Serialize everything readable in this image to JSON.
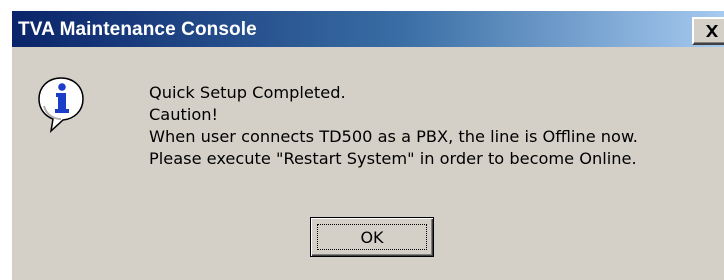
{
  "window": {
    "title": "TVA Maintenance Console",
    "close_glyph": "✕"
  },
  "icon": {
    "name": "info-icon",
    "colors": {
      "fill": "#ffffff",
      "glyph": "#1a3ec8",
      "outline": "#000000"
    }
  },
  "message": {
    "lines": [
      "Quick Setup Completed.",
      "Caution!",
      "When user connects TD500 as a PBX, the line is Offline now.",
      "Please execute \"Restart System\" in order to become Online."
    ]
  },
  "buttons": {
    "ok_label": "OK"
  },
  "colors": {
    "title_gradient_start": "#0a246a",
    "title_gradient_end": "#a6caf0",
    "dialog_bg": "#d4d0c8"
  }
}
